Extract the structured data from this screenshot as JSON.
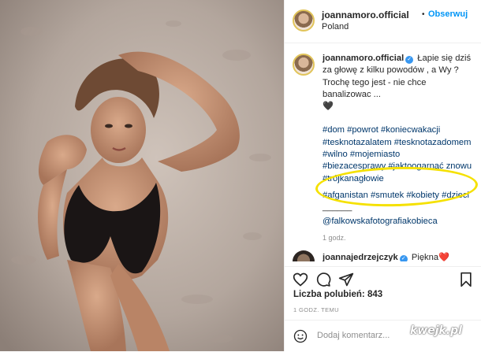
{
  "post": {
    "author": "joannamoro.official",
    "location": "Poland",
    "follow_label": "Obserwuj",
    "caption_lines": [
      "Łapie się dziś",
      "za głowę z kilku powodów , a Wy ?",
      "Trochę tego jest - nie chce",
      "banalizowac ...",
      "🖤"
    ],
    "hashtag_lines": [
      "#dom #powrot #koniecwakacji",
      "#tesknotazalatem #tesknotazadomem",
      "#wilno #mojemiasto",
      "#biezacesprawy #jaktoogarnąć znowu",
      "#trójkanagłowie"
    ],
    "highlighted_hashtags": "#afganistan #smutek #kobiety #dzieci",
    "separator": "______",
    "mention": "@falkowskafotografiakobieca",
    "caption_age": "1 godz.",
    "reply_author": "joannajedrzejczyk",
    "reply_text": "Piękna❤️",
    "likes_label": "Liczba polubień:",
    "likes_count": "843",
    "timestamp": "1 GODZ. TEMU",
    "comment_placeholder": "Dodaj komentarz...",
    "watermark": "kwejk.pl"
  },
  "icons": {
    "heart": "heart-icon",
    "comment": "comment-icon",
    "share": "paper-plane-icon",
    "save": "bookmark-icon",
    "emoji": "emoji-icon",
    "verified": "verified-badge-icon",
    "more": "more-dot-icon"
  },
  "colors": {
    "link_blue": "#0095f6",
    "hashtag": "#00376b",
    "highlight_marker": "#f5e100",
    "muted": "#8e8e8e"
  }
}
